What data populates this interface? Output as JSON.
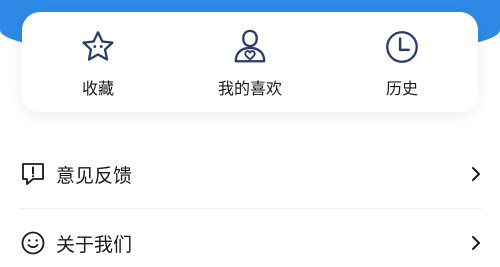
{
  "colors": {
    "brand_blue": "#2e8ae6",
    "icon_navy": "#2b3a67"
  },
  "quick_actions": [
    {
      "label": "收藏",
      "icon": "star-icon"
    },
    {
      "label": "我的喜欢",
      "icon": "user-heart-icon"
    },
    {
      "label": "历史",
      "icon": "clock-icon"
    }
  ],
  "menu": [
    {
      "label": "意见反馈",
      "icon": "feedback-icon"
    },
    {
      "label": "关于我们",
      "icon": "smile-icon"
    }
  ]
}
